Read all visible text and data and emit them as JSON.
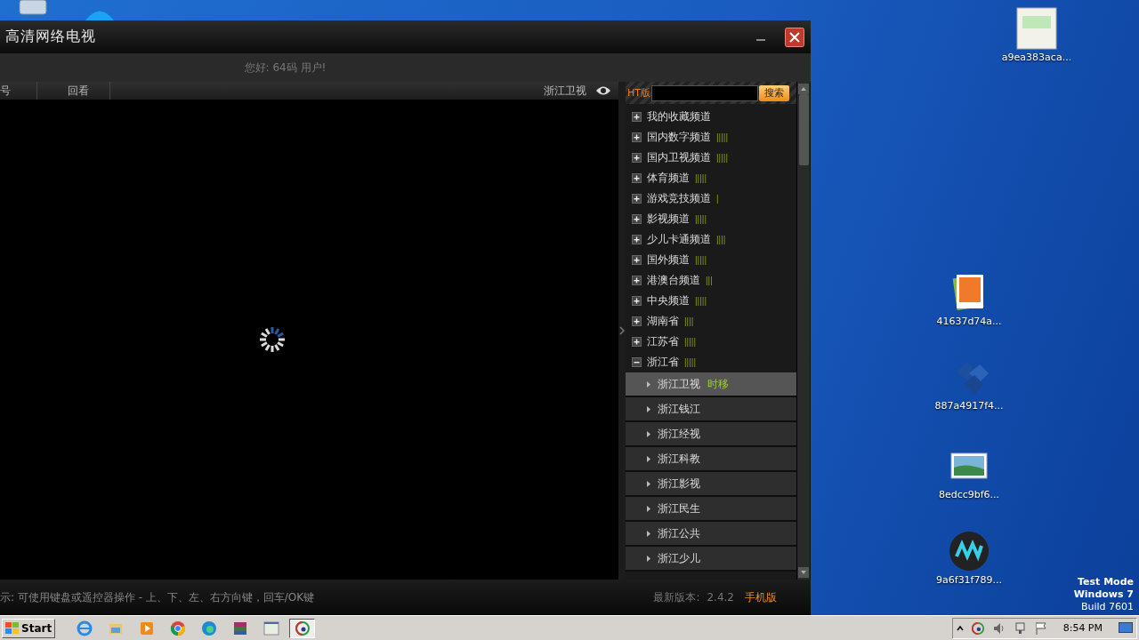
{
  "window": {
    "title": "高清网络电视",
    "greeting": "您好: 64码 用户!"
  },
  "tabs": [
    {
      "label": "号",
      "selected": false
    },
    {
      "label": "回看",
      "selected": false
    }
  ],
  "now_playing": "浙江卫视",
  "search": {
    "brand": "HT版",
    "button": "搜索"
  },
  "channel_groups": [
    {
      "label": "我的收藏频道",
      "expanded": false
    },
    {
      "label": "国内数字频道",
      "expanded": false,
      "signal": "|||||"
    },
    {
      "label": "国内卫视频道",
      "expanded": false,
      "signal": "|||||"
    },
    {
      "label": "体育频道",
      "expanded": false,
      "signal": "|||||"
    },
    {
      "label": "游戏竞技频道",
      "expanded": false,
      "signal": "|"
    },
    {
      "label": "影视频道",
      "expanded": false,
      "signal": "|||||"
    },
    {
      "label": "少儿卡通频道",
      "expanded": false,
      "signal": "||||"
    },
    {
      "label": "国外频道",
      "expanded": false,
      "signal": "|||||"
    },
    {
      "label": "港澳台频道",
      "expanded": false,
      "signal": "|||"
    },
    {
      "label": "中央频道",
      "expanded": false,
      "signal": "|||||"
    },
    {
      "label": "湖南省",
      "expanded": false,
      "signal": "||||"
    },
    {
      "label": "江苏省",
      "expanded": false,
      "signal": "|||||"
    },
    {
      "label": "浙江省",
      "expanded": true,
      "signal": "|||||",
      "children": [
        {
          "label": "浙江卫视",
          "tag": "时移",
          "selected": true
        },
        {
          "label": "浙江钱江",
          "selected": false
        },
        {
          "label": "浙江经视",
          "selected": false
        },
        {
          "label": "浙江科教",
          "selected": false
        },
        {
          "label": "浙江影视",
          "selected": false
        },
        {
          "label": "浙江民生",
          "selected": false
        },
        {
          "label": "浙江公共",
          "selected": false
        },
        {
          "label": "浙江少儿",
          "selected": false
        }
      ]
    }
  ],
  "status_bar": {
    "hint": "示:  可使用键盘或遥控器操作 - 上、下、左、右方向键，回车/OK键",
    "version_label": "最新版本:",
    "version": "2.4.2",
    "mobile_link": "手机版"
  },
  "desktop_icons": [
    {
      "label": "a9ea383aca...",
      "kind": "document"
    },
    {
      "label": "41637d74a...",
      "kind": "photo"
    },
    {
      "label": "887a4917f4...",
      "kind": "cubes"
    },
    {
      "label": "8edcc9bf6...",
      "kind": "image"
    },
    {
      "label": "9a6f31f789...",
      "kind": "audio"
    }
  ],
  "os_notice": [
    "Test Mode",
    "Windows 7",
    "Build 7601"
  ],
  "taskbar": {
    "start": "Start",
    "apps": [
      {
        "kind": "ie",
        "selected": false
      },
      {
        "kind": "folder",
        "selected": false
      },
      {
        "kind": "player",
        "selected": false
      },
      {
        "kind": "chrome",
        "selected": false
      },
      {
        "kind": "edge",
        "selected": false
      },
      {
        "kind": "archive",
        "selected": false
      },
      {
        "kind": "window",
        "selected": false
      },
      {
        "kind": "tv",
        "selected": true
      }
    ],
    "clock": "8:54 PM"
  }
}
